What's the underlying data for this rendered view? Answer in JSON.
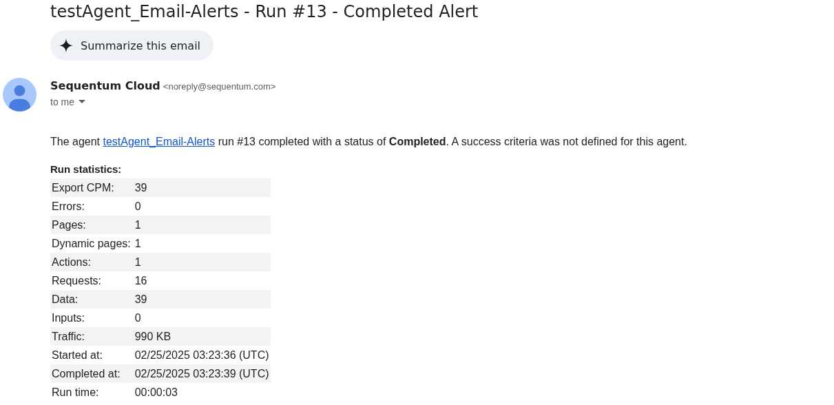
{
  "subject": "testAgent_Email-Alerts - Run #13 - Completed Alert",
  "summarize_button": {
    "label": "Summarize this email"
  },
  "sender": {
    "name": "Sequentum Cloud",
    "address": "<noreply@sequentum.com>",
    "recipient": "to me"
  },
  "body": {
    "before": "The agent ",
    "link": "testAgent_Email-Alerts",
    "after": " run #13 completed with a status of **Completed**. A success criteria was not defined for this agent."
  },
  "stats_heading": "Run statistics:",
  "stats": [
    {
      "label": "Export CPM:",
      "value": "39"
    },
    {
      "label": "Errors:",
      "value": "0"
    },
    {
      "label": "Pages:",
      "value": "1"
    },
    {
      "label": "Dynamic pages:",
      "value": "1"
    },
    {
      "label": "Actions:",
      "value": "1"
    },
    {
      "label": "Requests:",
      "value": "16"
    },
    {
      "label": "Data:",
      "value": "39"
    },
    {
      "label": "Inputs:",
      "value": "0"
    },
    {
      "label": "Traffic:",
      "value": "990 KB"
    },
    {
      "label": "Started at:",
      "value": "02/25/2025 03:23:36 (UTC)"
    },
    {
      "label": "Completed at:",
      "value": "02/25/2025 03:23:39 (UTC)"
    },
    {
      "label": "Run time:",
      "value": "00:00:03"
    }
  ]
}
